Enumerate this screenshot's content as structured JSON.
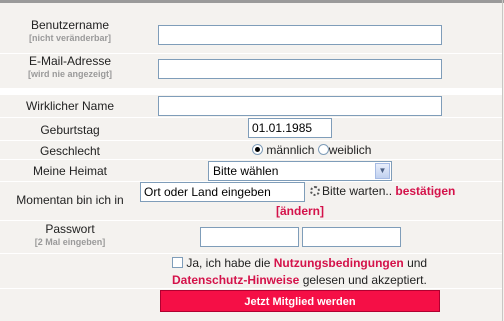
{
  "fields": {
    "username": {
      "label": "Benutzername",
      "hint": "[nicht veränderbar]",
      "value": ""
    },
    "email": {
      "label": "E-Mail-Adresse",
      "hint": "[wird nie angezeigt]",
      "value": ""
    },
    "real_name": {
      "label": "Wirklicher Name",
      "value": ""
    },
    "birthday": {
      "label": "Geburtstag",
      "value": "01.01.1985"
    },
    "gender": {
      "label": "Geschlecht",
      "option_male": "männlich",
      "option_female": "weiblich",
      "selected": "männlich"
    },
    "home": {
      "label": "Meine Heimat",
      "selected": "Bitte wählen"
    },
    "location": {
      "label": "Momentan bin ich in",
      "value": "Ort oder Land eingeben",
      "waiting": "Bitte warten..",
      "confirm": "bestätigen",
      "change": "[ändern]"
    },
    "password": {
      "label": "Passwort",
      "hint": "[2 Mal eingeben]",
      "value1": "",
      "value2": ""
    }
  },
  "terms": {
    "prefix": "Ja, ich habe die",
    "link1": "Nutzungsbedingungen",
    "and": "und",
    "link2": "Datenschutz-Hinweise",
    "suffix": "gelesen und akzeptiert.",
    "checked": false
  },
  "submit_label": "Jetzt Mitglied werden",
  "colors": {
    "accent": "#f50f46",
    "link_red": "#d4124a",
    "background": "#f4f2ef"
  }
}
